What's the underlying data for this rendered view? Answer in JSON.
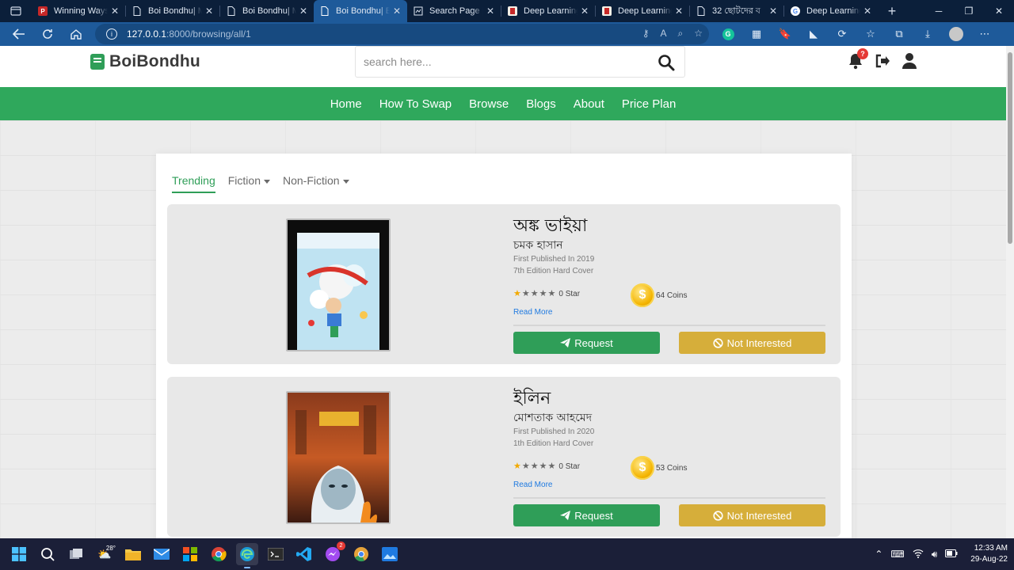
{
  "browser": {
    "tabs": [
      {
        "title": "Winning Ways",
        "favicon": "pdf",
        "color": "#c62828"
      },
      {
        "title": "Boi Bondhu| M",
        "favicon": "doc",
        "color": "#e6eef8"
      },
      {
        "title": "Boi Bondhu| M",
        "favicon": "doc",
        "color": "#e6eef8"
      },
      {
        "title": "Boi Bondhu| B",
        "favicon": "doc",
        "color": "#e6eef8",
        "active": true
      },
      {
        "title": "Search Page |",
        "favicon": "page",
        "color": "#e6eef8"
      },
      {
        "title": "Deep Learning",
        "favicon": "book",
        "color": "#c62828"
      },
      {
        "title": "Deep Learning",
        "favicon": "book",
        "color": "#c62828"
      },
      {
        "title": "32 ছোটদের ব",
        "favicon": "doc",
        "color": "#e6eef8"
      },
      {
        "title": "Deep Learning",
        "favicon": "google",
        "color": "#4285f4"
      }
    ],
    "url_host": "127.0.0.1",
    "url_path": ":8000/browsing/all/1"
  },
  "site": {
    "logo": "BoiBondhu",
    "search_placeholder": "search here...",
    "notification_count": "?",
    "nav": [
      "Home",
      "How To Swap",
      "Browse",
      "Blogs",
      "About",
      "Price Plan"
    ]
  },
  "filters": {
    "trending": "Trending",
    "fiction": "Fiction",
    "non_fiction": "Non-Fiction"
  },
  "books": [
    {
      "title": "অঙ্ক ভাইয়া",
      "author": "চমক হাসান",
      "published": "First Published In 2019",
      "edition": "7th Edition Hard Cover",
      "stars": 0,
      "star_label": "0 Star",
      "coins": "64 Coins",
      "read_more": "Read More",
      "request": "Request",
      "not_interested": "Not Interested"
    },
    {
      "title": "ইলিন",
      "author": "মোশতাক আহমেদ",
      "published": "First Published In 2020",
      "edition": "1th Edition Hard Cover",
      "stars": 0,
      "star_label": "0 Star",
      "coins": "53 Coins",
      "read_more": "Read More",
      "request": "Request",
      "not_interested": "Not Interested"
    }
  ],
  "taskbar": {
    "weather": "28°",
    "messenger_badge": "2",
    "time": "12:33 AM",
    "date": "29-Aug-22"
  },
  "colors": {
    "brand_green": "#2fa85c",
    "not_interested_gold": "#d6ae3a",
    "link_blue": "#1f7ae0"
  }
}
